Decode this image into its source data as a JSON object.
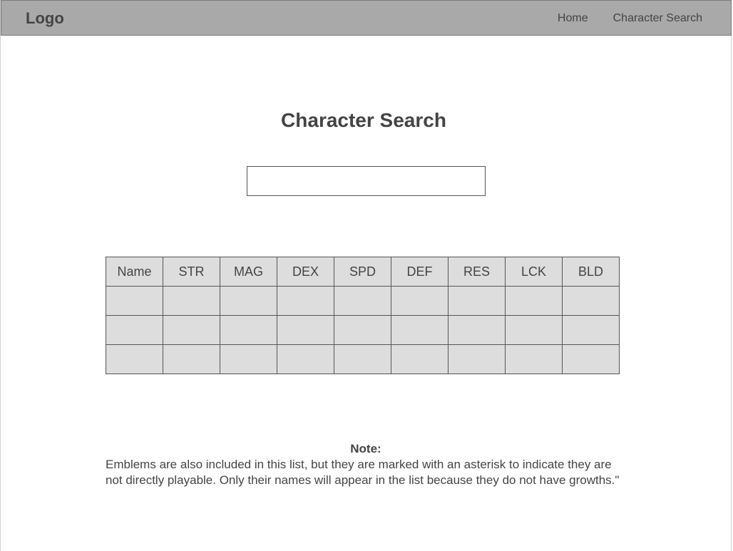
{
  "navbar": {
    "logo": "Logo",
    "links": [
      {
        "label": "Home"
      },
      {
        "label": "Character Search"
      }
    ]
  },
  "main": {
    "title": "Character Search",
    "search": {
      "value": "",
      "placeholder": ""
    },
    "table": {
      "columns": [
        "Name",
        "STR",
        "MAG",
        "DEX",
        "SPD",
        "DEF",
        "RES",
        "LCK",
        "BLD"
      ],
      "rows": [
        [
          "",
          "",
          "",
          "",
          "",
          "",
          "",
          "",
          ""
        ],
        [
          "",
          "",
          "",
          "",
          "",
          "",
          "",
          "",
          ""
        ],
        [
          "",
          "",
          "",
          "",
          "",
          "",
          "",
          "",
          ""
        ]
      ]
    },
    "note": {
      "heading": "Note:",
      "text": "Emblems are also included in this list, but they are marked with an asterisk to indicate they are not directly playable. Only their names will appear in the list because they do not have growths.\""
    }
  }
}
